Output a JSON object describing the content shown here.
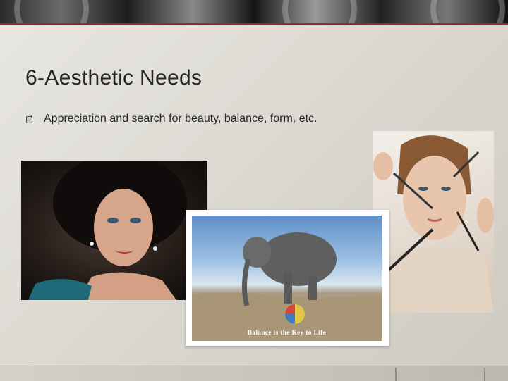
{
  "slide": {
    "title": "6-Aesthetic Needs",
    "bullets": [
      {
        "icon": "square-bullet-icon",
        "text": "Appreciation and search for beauty, balance, form, etc."
      }
    ]
  },
  "images": {
    "portrait": {
      "icon": "portrait-photo"
    },
    "makeup": {
      "icon": "makeup-brushes-photo"
    },
    "elephant": {
      "icon": "elephant-on-ball-photo",
      "caption": "Balance is the Key to Life"
    }
  },
  "colors": {
    "background": "#dcd9d3",
    "banner_rule": "#8e2d2d",
    "text": "#262626"
  }
}
